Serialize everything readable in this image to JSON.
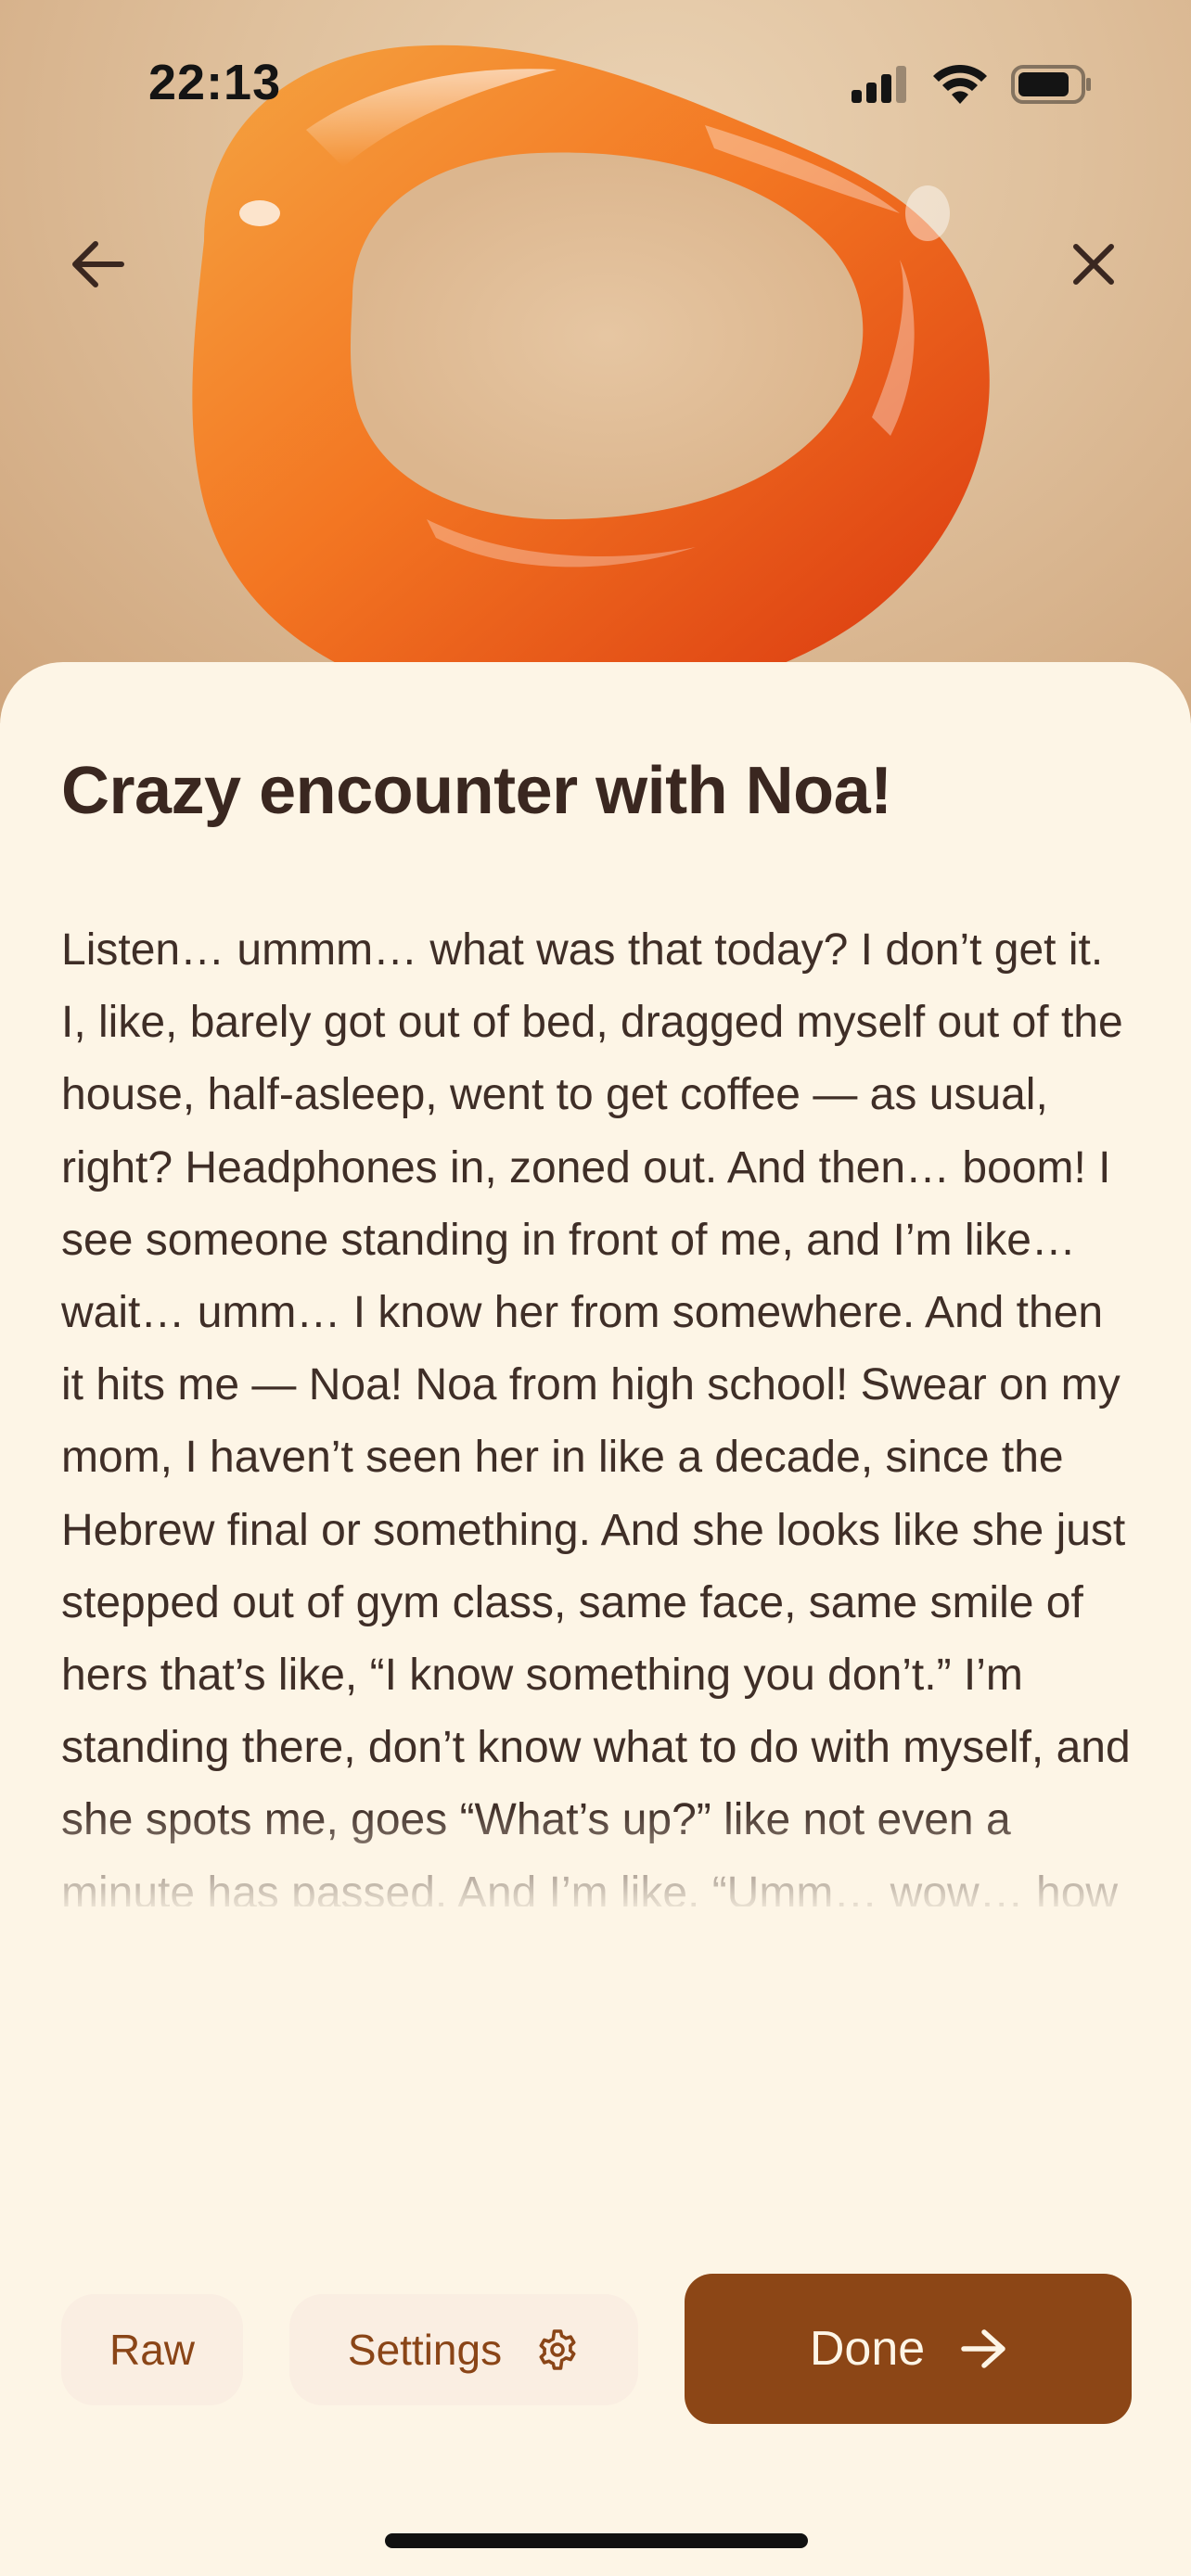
{
  "status_bar": {
    "time": "22:13",
    "icons": [
      "signal-icon",
      "wifi-icon",
      "battery-icon"
    ]
  },
  "nav": {
    "back_icon": "arrow-left-icon",
    "close_icon": "close-icon"
  },
  "entry": {
    "title": "Crazy encounter with Noa!",
    "body": "Listen… ummm… what was that today? I don’t get it. I, like, barely got out of bed, dragged myself out of the house, half-asleep, went to get coffee — as usual, right? Headphones in, zoned out. And then… boom! I see someone standing in front of me, and I’m like… wait… umm… I know her from somewhere. And then it hits me — Noa! Noa from high school! Swear on my mom, I haven’t seen her in like a decade, since the Hebrew final or something. And she looks like she just stepped out of gym class, same face, same smile of hers that’s like, “I know something you don’t.” I’m standing there, don’t know what to do with myself, and she spots me, goes “What’s up?” like not even a minute has passed. And I’m like, “Umm… wow… how are you?” And you know those conversations that are supposedly small talk — but there’s something"
  },
  "actions": {
    "raw_label": "Raw",
    "settings_label": "Settings",
    "settings_icon": "gear-icon",
    "done_label": "Done",
    "done_icon": "arrow-right-icon"
  },
  "colors": {
    "sheet_background": "#fdf5e6",
    "primary_button": "#8c4616",
    "secondary_button": "#faeee2",
    "accent_text": "#8a4517",
    "title_text": "#3a2720",
    "body_text": "#3f2e27",
    "hero_background": "#dfc09c",
    "ring_orange": "#f26a1b"
  }
}
